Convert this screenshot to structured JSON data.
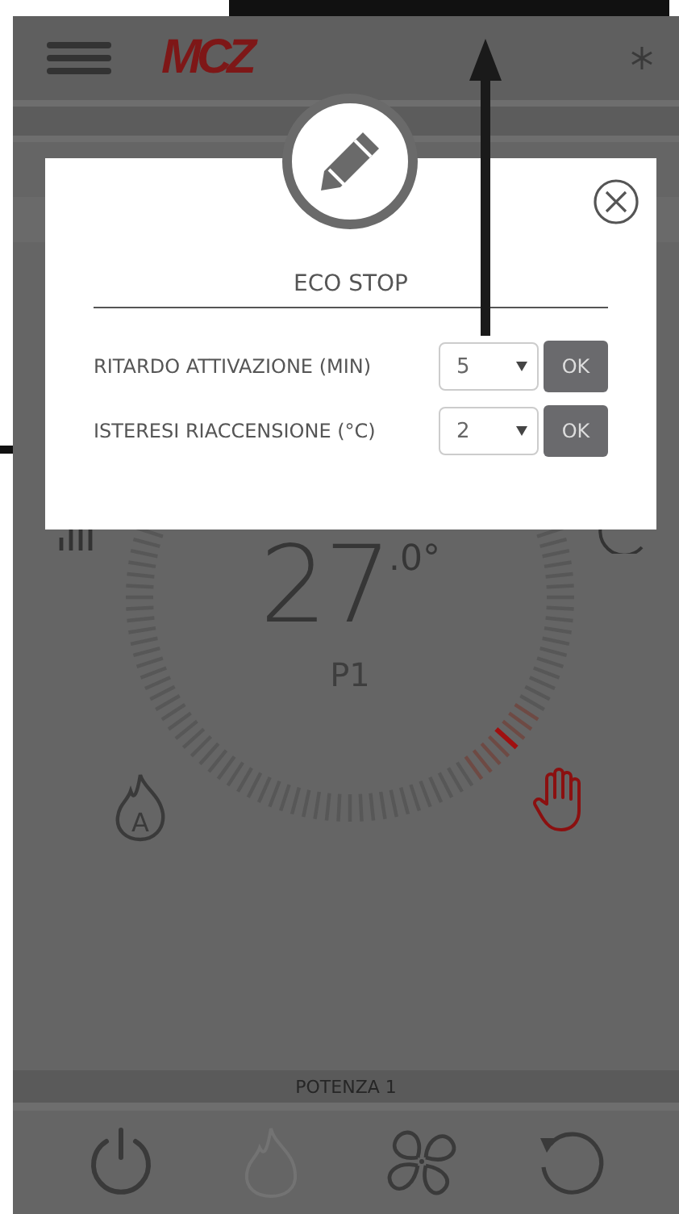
{
  "header": {
    "logo": "MCZ"
  },
  "dial": {
    "temperature": "27",
    "decimal": ".0°",
    "power": "P1"
  },
  "modes": [
    {
      "kind": "auto-flame",
      "selected": false,
      "glyph": "A"
    },
    {
      "kind": "manual",
      "selected": true
    }
  ],
  "status_bar": {
    "label": "POTENZA 1"
  },
  "bottom_buttons": [
    {
      "kind": "power",
      "disabled": false
    },
    {
      "kind": "flame",
      "disabled": true
    },
    {
      "kind": "fan",
      "disabled": false
    },
    {
      "kind": "reset",
      "disabled": false
    }
  ],
  "dialog": {
    "title": "ECO STOP",
    "fields": [
      {
        "label": "RITARDO ATTIVAZIONE (MIN)",
        "value": "5",
        "button": "OK"
      },
      {
        "label": "ISTERESI RIACCENSIONE (°C)",
        "value": "2",
        "button": "OK"
      }
    ]
  }
}
